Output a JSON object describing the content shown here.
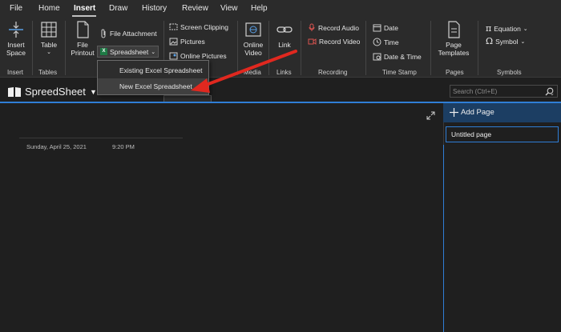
{
  "menu": {
    "tabs": [
      "File",
      "Home",
      "Insert",
      "Draw",
      "History",
      "Review",
      "View",
      "Help"
    ],
    "active": "Insert"
  },
  "ribbon": {
    "insert_space": "Insert Space",
    "table": "Table",
    "file_printout": "File Printout",
    "file_attachment": "File Attachment",
    "spreadsheet": "Spreadsheet",
    "screen_clipping": "Screen Clipping",
    "pictures": "Pictures",
    "online_pictures": "Online Pictures",
    "online_video": "Online Video",
    "link": "Link",
    "record_audio": "Record Audio",
    "record_video": "Record Video",
    "date": "Date",
    "time": "Time",
    "date_time": "Date & Time",
    "page_templates": "Page Templates",
    "equation": "Equation",
    "symbol": "Symbol",
    "groups": {
      "insert": "Insert",
      "tables": "Tables",
      "media": "Media",
      "links": "Links",
      "recording": "Recording",
      "time_stamp": "Time Stamp",
      "pages": "Pages",
      "symbols": "Symbols"
    }
  },
  "dropdown": {
    "items": [
      "Existing Excel Spreadsheet",
      "New Excel Spreadsheet"
    ],
    "hovered": "New Excel Spreadsheet"
  },
  "notebook": {
    "name": "SpreedSheet"
  },
  "search": {
    "placeholder": "Search (Ctrl+E)"
  },
  "page": {
    "date": "Sunday, April 25, 2021",
    "time": "9:20 PM"
  },
  "pages_pane": {
    "add_page": "Add Page",
    "pages": [
      "Untitled page"
    ]
  },
  "colors": {
    "accent_blue": "#2f7ed6",
    "selected_bg": "#1c3e63",
    "annotation_arrow": "#e0281f",
    "excel_green": "#1e7a45"
  }
}
